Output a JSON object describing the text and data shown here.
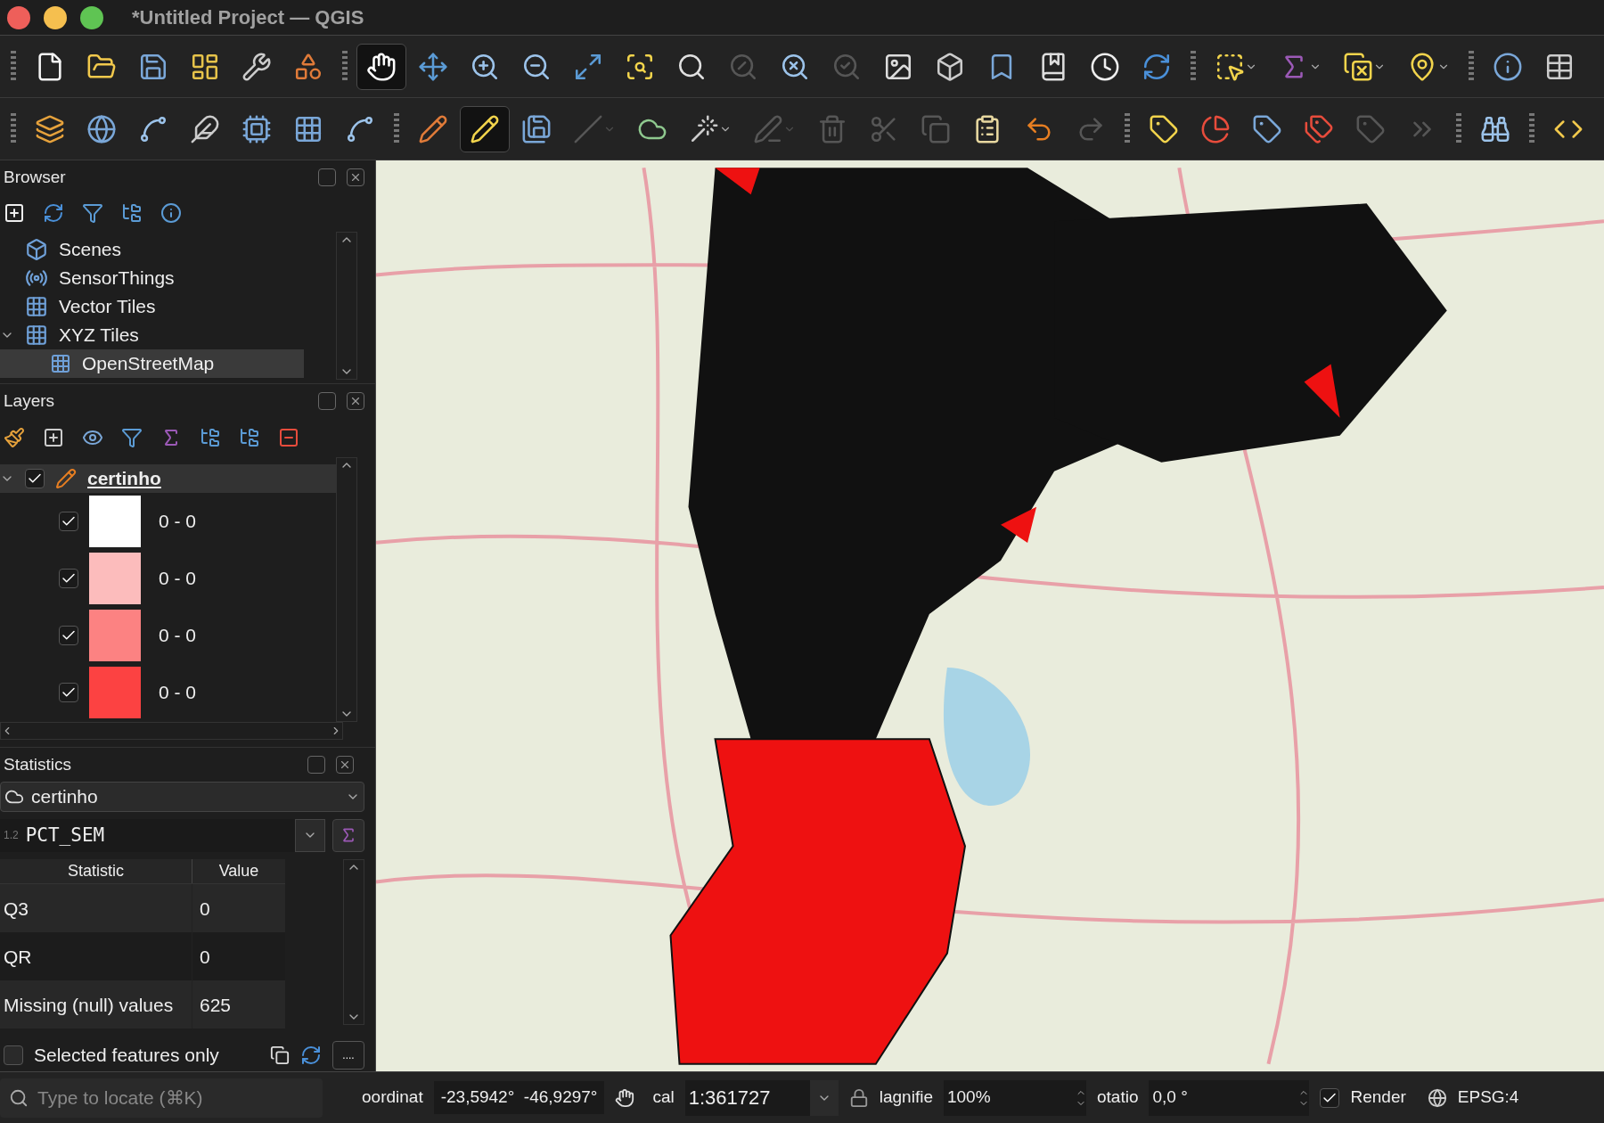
{
  "window": {
    "title": "*Untitled Project — QGIS"
  },
  "toolbars": [
    {
      "groups": [
        {
          "buttons": [
            {
              "kind": "new",
              "pressed": false,
              "disabled": false
            },
            {
              "kind": "open",
              "pressed": false,
              "disabled": false
            },
            {
              "kind": "save",
              "pressed": false,
              "disabled": false
            },
            {
              "kind": "layout",
              "pressed": false,
              "disabled": false
            },
            {
              "kind": "manager",
              "pressed": false,
              "disabled": false
            },
            {
              "kind": "style",
              "pressed": false,
              "disabled": false
            }
          ]
        },
        {
          "buttons": [
            {
              "kind": "pan",
              "pressed": true,
              "disabled": false
            },
            {
              "kind": "pantosel",
              "pressed": false,
              "disabled": false
            },
            {
              "kind": "zoomin",
              "pressed": false,
              "disabled": false
            },
            {
              "kind": "zoomout",
              "pressed": false,
              "disabled": false
            },
            {
              "kind": "zoomfull",
              "pressed": false,
              "disabled": false
            },
            {
              "kind": "zoomsel",
              "pressed": false,
              "disabled": false
            },
            {
              "kind": "zoomlayer",
              "pressed": false,
              "disabled": false
            },
            {
              "kind": "zoomnative",
              "pressed": false,
              "disabled": true
            },
            {
              "kind": "zoomlast",
              "pressed": false,
              "disabled": false
            },
            {
              "kind": "zoomnext",
              "pressed": false,
              "disabled": true
            },
            {
              "kind": "decoration",
              "pressed": false,
              "disabled": false
            },
            {
              "kind": "map3d",
              "pressed": false,
              "disabled": false
            },
            {
              "kind": "bookmark",
              "pressed": false,
              "disabled": false
            },
            {
              "kind": "bookmarks",
              "pressed": false,
              "disabled": false
            },
            {
              "kind": "clock",
              "pressed": false,
              "disabled": false
            },
            {
              "kind": "refresh",
              "pressed": false,
              "disabled": false
            }
          ]
        },
        {
          "buttons": [
            {
              "kind": "select",
              "pressed": false,
              "disabled": false
            },
            {
              "kind": "selectexpr",
              "pressed": false,
              "disabled": false
            },
            {
              "kind": "deselect",
              "pressed": false,
              "disabled": false
            },
            {
              "kind": "selectloc",
              "pressed": false,
              "disabled": false
            }
          ]
        },
        {
          "buttons": [
            {
              "kind": "identify",
              "pressed": false,
              "disabled": false
            },
            {
              "kind": "table",
              "pressed": false,
              "disabled": false
            }
          ]
        }
      ]
    },
    {
      "groups": [
        {
          "buttons": [
            {
              "kind": "addlayer",
              "pressed": false,
              "disabled": false
            },
            {
              "kind": "globe",
              "pressed": false,
              "disabled": false
            },
            {
              "kind": "vertex",
              "pressed": false,
              "disabled": false
            },
            {
              "kind": "feather",
              "pressed": false,
              "disabled": false
            },
            {
              "kind": "raster",
              "pressed": false,
              "disabled": false
            },
            {
              "kind": "mesh",
              "pressed": false,
              "disabled": false
            },
            {
              "kind": "polyvertex",
              "pressed": false,
              "disabled": false
            }
          ]
        },
        {
          "buttons": [
            {
              "kind": "edits",
              "pressed": false,
              "disabled": false
            },
            {
              "kind": "toggleedit",
              "pressed": true,
              "disabled": false
            },
            {
              "kind": "saveedits",
              "pressed": false,
              "disabled": false
            },
            {
              "kind": "digitize",
              "pressed": false,
              "disabled": true
            },
            {
              "kind": "addpolygon",
              "pressed": false,
              "disabled": false
            },
            {
              "kind": "vertextool",
              "pressed": false,
              "disabled": false
            },
            {
              "kind": "attributes",
              "pressed": false,
              "disabled": true
            },
            {
              "kind": "delete",
              "pressed": false,
              "disabled": true
            },
            {
              "kind": "cut",
              "pressed": false,
              "disabled": true
            },
            {
              "kind": "copy",
              "pressed": false,
              "disabled": true
            },
            {
              "kind": "paste",
              "pressed": false,
              "disabled": false
            },
            {
              "kind": "undo",
              "pressed": false,
              "disabled": false
            },
            {
              "kind": "redo",
              "pressed": false,
              "disabled": true
            }
          ]
        },
        {
          "buttons": [
            {
              "kind": "label",
              "pressed": false,
              "disabled": false
            },
            {
              "kind": "diagram",
              "pressed": false,
              "disabled": false
            },
            {
              "kind": "pinlabel",
              "pressed": false,
              "disabled": false
            },
            {
              "kind": "highlightlabel",
              "pressed": false,
              "disabled": false
            },
            {
              "kind": "movelabel",
              "pressed": false,
              "disabled": true
            },
            {
              "kind": "more",
              "pressed": false,
              "disabled": true
            }
          ]
        },
        {
          "buttons": [
            {
              "kind": "binoculars",
              "pressed": false,
              "disabled": false
            }
          ]
        },
        {
          "buttons": [
            {
              "kind": "python",
              "pressed": false,
              "disabled": false
            }
          ]
        }
      ]
    }
  ],
  "browser": {
    "title": "Browser",
    "items": [
      {
        "kind": "scenes",
        "label": "Scenes",
        "selected": false
      },
      {
        "kind": "sensor",
        "label": "SensorThings",
        "selected": false
      },
      {
        "kind": "tiles",
        "label": "Vector Tiles",
        "selected": false
      },
      {
        "kind": "tiles",
        "label": "XYZ Tiles",
        "expanded": true,
        "selected": false,
        "children": [
          {
            "kind": "tiles",
            "label": "OpenStreetMap",
            "selected": true
          }
        ]
      }
    ]
  },
  "layers": {
    "title": "Layers",
    "items": [
      {
        "label": "certinho",
        "checked": true,
        "expanded": true,
        "selected": true,
        "children": [
          {
            "label": "0 - 0",
            "checked": true,
            "color": "#ffffff"
          },
          {
            "label": "0 - 0",
            "checked": true,
            "color": "#fcbcbc"
          },
          {
            "label": "0 - 0",
            "checked": true,
            "color": "#fc8282"
          },
          {
            "label": "0 - 0",
            "checked": true,
            "color": "#fc4242"
          }
        ]
      }
    ]
  },
  "statistics": {
    "title": "Statistics",
    "layer": "certinho",
    "field_type": "1.2",
    "field": "PCT_SEM",
    "columns": [
      "Statistic",
      "Value"
    ],
    "rows": [
      {
        "statistic": "Q3",
        "value": "0"
      },
      {
        "statistic": "QR",
        "value": "0"
      },
      {
        "statistic": "Missing (null) values",
        "value": "625"
      }
    ],
    "selected_only": {
      "label": "Selected features only",
      "checked": false
    },
    "more_button": "...."
  },
  "locator": {
    "placeholder": "Type to locate (⌘K)"
  },
  "status_bar": {
    "coordinate_label": "oordinat",
    "coordinate": "-23,5942°  -46,9297°",
    "scale_label": "cal",
    "scale": "1:361727",
    "magnifier_label": "lagnifie",
    "magnifier": "100%",
    "rotation_label": "otatio",
    "rotation": "0,0 °",
    "render": {
      "label": "Render",
      "checked": true
    },
    "crs": "EPSG:4"
  }
}
